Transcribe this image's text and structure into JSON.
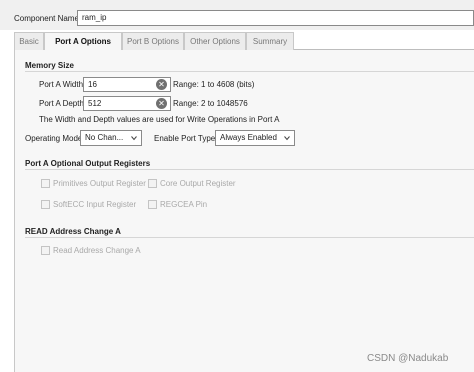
{
  "component_name": {
    "label": "Component Name",
    "value": "ram_ip"
  },
  "tabs": [
    {
      "label": "Basic"
    },
    {
      "label": "Port A Options"
    },
    {
      "label": "Port B Options"
    },
    {
      "label": "Other Options"
    },
    {
      "label": "Summary"
    }
  ],
  "active_tab": "Port A Options",
  "memory_size": {
    "title": "Memory Size",
    "width_label": "Port A Width",
    "width_value": "16",
    "width_range": "Range: 1 to 4608 (bits)",
    "depth_label": "Port A Depth",
    "depth_value": "512",
    "depth_range": "Range: 2 to 1048576",
    "note": "The Width and Depth values are used for Write Operations in Port A"
  },
  "operating_mode": {
    "label": "Operating Mode",
    "value": "No Chan..."
  },
  "enable_port": {
    "label": "Enable Port Type",
    "value": "Always Enabled"
  },
  "output_registers": {
    "title": "Port A Optional Output Registers",
    "primitives": "Primitives Output Register",
    "core": "Core Output Register",
    "softecc": "SoftECC Input Register",
    "regcea": "REGCEA Pin"
  },
  "address_change": {
    "title": "READ Address Change A",
    "read": "Read Address Change A"
  },
  "watermark": "CSDN @Nadukab"
}
